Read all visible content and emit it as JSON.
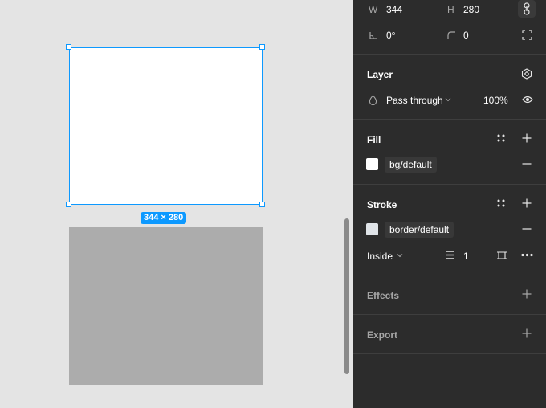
{
  "canvas": {
    "size_badge": "344 × 280"
  },
  "panel": {
    "dimensions": {
      "w_label": "W",
      "w_value": "344",
      "h_label": "H",
      "h_value": "280",
      "rotation_value": "0°",
      "radius_value": "0"
    },
    "layer": {
      "title": "Layer",
      "blend_mode": "Pass through",
      "opacity": "100%"
    },
    "fill": {
      "title": "Fill",
      "style_name": "bg/default",
      "swatch_color": "#ffffff"
    },
    "stroke": {
      "title": "Stroke",
      "style_name": "border/default",
      "swatch_color": "#e0e4e8",
      "position": "Inside",
      "weight": "1"
    },
    "effects": {
      "title": "Effects"
    },
    "export": {
      "title": "Export"
    }
  },
  "colors": {
    "accent": "#0d99ff",
    "panel_bg": "#2c2c2c",
    "canvas_bg": "#e4e4e4"
  }
}
